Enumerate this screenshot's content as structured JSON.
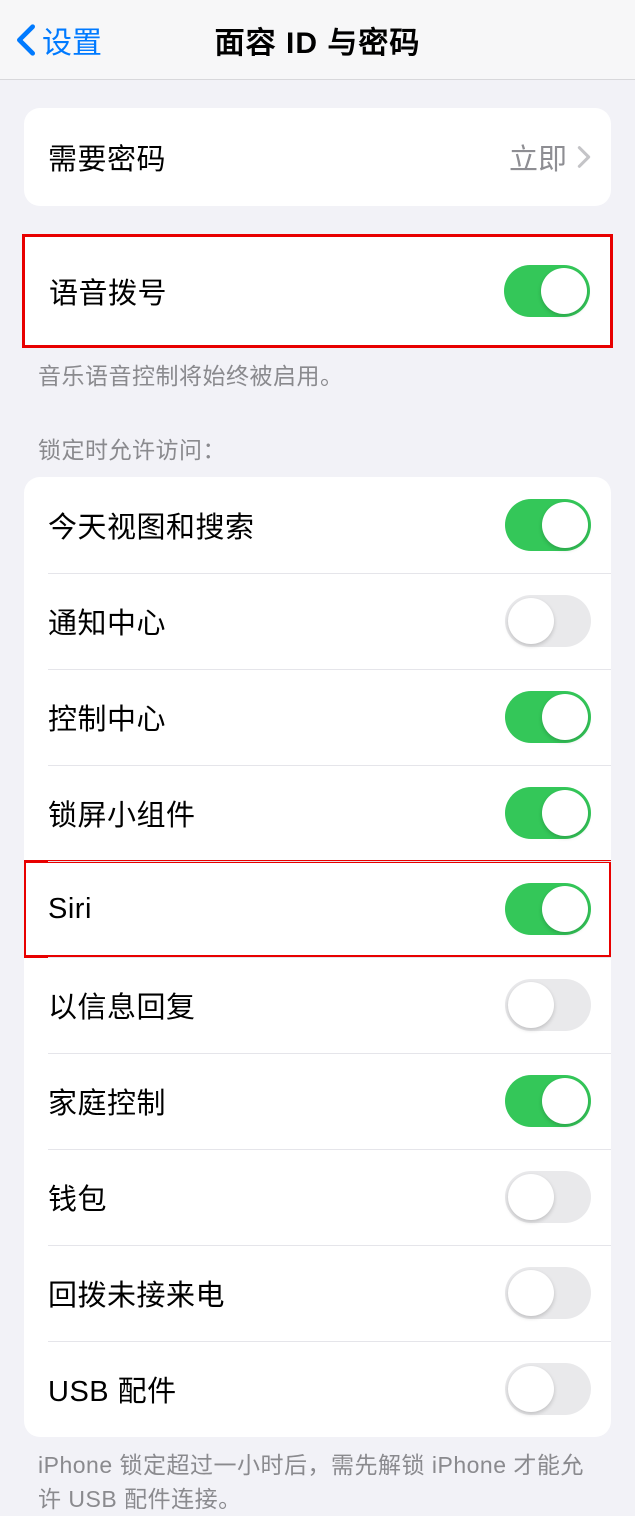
{
  "nav": {
    "back_label": "设置",
    "title": "面容 ID 与密码"
  },
  "require_passcode": {
    "label": "需要密码",
    "value": "立即"
  },
  "voice_dial": {
    "label": "语音拨号",
    "on": true,
    "footer": "音乐语音控制将始终被启用。"
  },
  "access": {
    "header": "锁定时允许访问：",
    "items": [
      {
        "label": "今天视图和搜索",
        "on": true,
        "name": "today-view-search"
      },
      {
        "label": "通知中心",
        "on": false,
        "name": "notification-center"
      },
      {
        "label": "控制中心",
        "on": true,
        "name": "control-center"
      },
      {
        "label": "锁屏小组件",
        "on": true,
        "name": "lockscreen-widgets"
      },
      {
        "label": "Siri",
        "on": true,
        "name": "siri",
        "highlight": true
      },
      {
        "label": "以信息回复",
        "on": false,
        "name": "reply-with-message"
      },
      {
        "label": "家庭控制",
        "on": true,
        "name": "home-control"
      },
      {
        "label": "钱包",
        "on": false,
        "name": "wallet"
      },
      {
        "label": "回拨未接来电",
        "on": false,
        "name": "return-missed-calls"
      },
      {
        "label": "USB 配件",
        "on": false,
        "name": "usb-accessories"
      }
    ],
    "footer": "iPhone 锁定超过一小时后，需先解锁 iPhone 才能允许 USB 配件连接。"
  }
}
